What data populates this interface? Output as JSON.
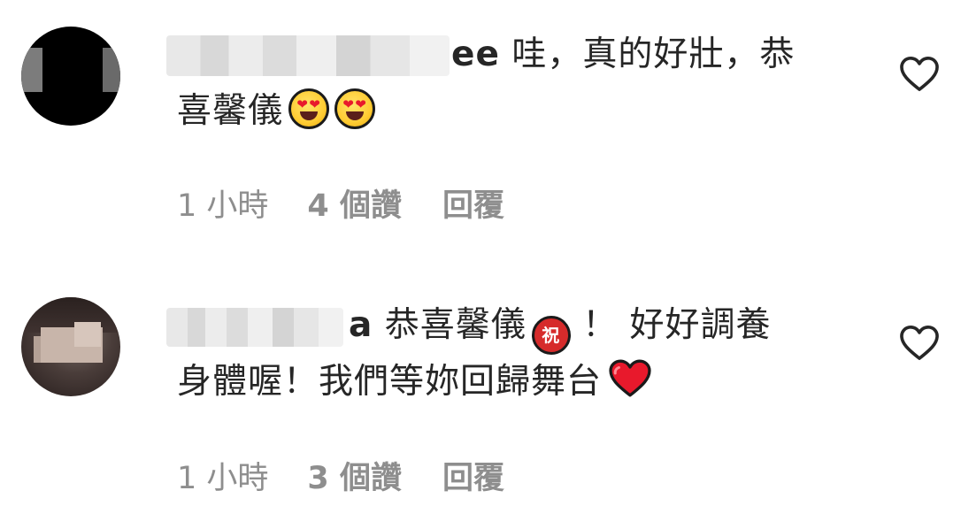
{
  "comments": [
    {
      "username_visible_suffix": "ee",
      "text_line1": "哇，真的好壯，恭",
      "text_line2": "喜馨儀",
      "emojis": [
        "smiling-face-with-heart-eyes",
        "smiling-face-with-heart-eyes"
      ],
      "time": "1 小時",
      "likes": "4 個讚",
      "reply": "回覆"
    },
    {
      "username_visible_suffix": "a",
      "text_line1": "恭喜馨儀",
      "badge": "祝",
      "text_line1_after": "！ 好好調養",
      "text_line2": "身體喔！我們等妳回歸舞台",
      "emojis": [
        "red-heart"
      ],
      "time": "1 小時",
      "likes": "3 個讚",
      "reply": "回覆"
    }
  ],
  "colors": {
    "text": "#262626",
    "meta": "#8e8e8e",
    "heart_emoji": "#e8192c"
  }
}
